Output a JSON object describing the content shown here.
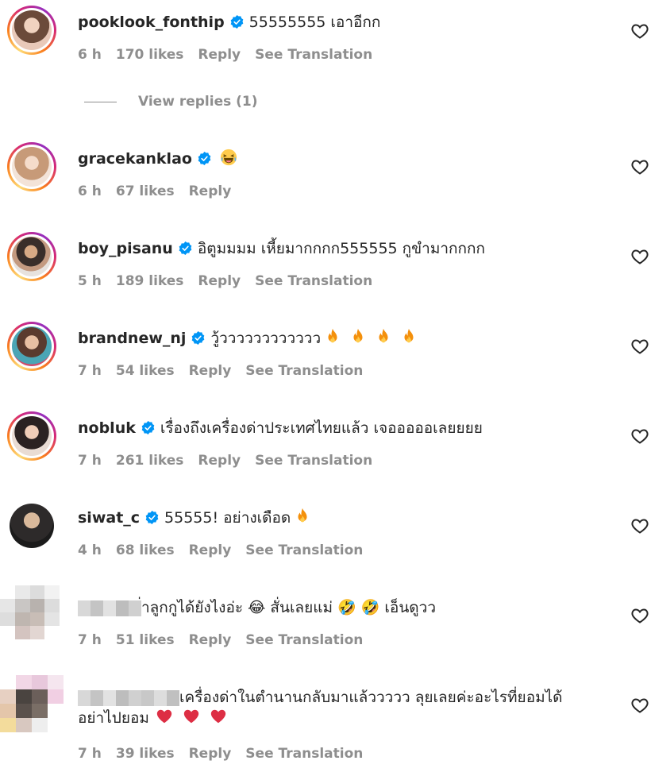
{
  "comments": [
    {
      "username": "pooklook_fonthip",
      "verified": true,
      "text": "55555555 เอาอีกก",
      "emojis": [],
      "time": "6 h",
      "likes": "170 likes",
      "reply": "Reply",
      "translation": "See Translation",
      "replies_link": "View replies (1)"
    },
    {
      "username": "gracekanklao",
      "verified": true,
      "text": "",
      "emojis": [
        "laughing"
      ],
      "time": "6 h",
      "likes": "67 likes",
      "reply": "Reply",
      "translation": ""
    },
    {
      "username": "boy_pisanu",
      "verified": true,
      "text": "อิตูมมมม เหี้ยมากกกก555555 กูขำมากกกก",
      "emojis": [],
      "time": "5 h",
      "likes": "189 likes",
      "reply": "Reply",
      "translation": "See Translation"
    },
    {
      "username": "brandnew_nj",
      "verified": true,
      "text": "วู้วววววววววววว",
      "emojis": [
        "fire",
        "fire",
        "fire",
        "fire"
      ],
      "time": "7 h",
      "likes": "54 likes",
      "reply": "Reply",
      "translation": "See Translation"
    },
    {
      "username": "nobluk",
      "verified": true,
      "text": "เรื่องถึงเครื่องด่าประเทศไทยแล้ว เจอออออเลยยยย",
      "emojis": [],
      "time": "7 h",
      "likes": "261 likes",
      "reply": "Reply",
      "translation": "See Translation"
    },
    {
      "username": "siwat_c",
      "verified": true,
      "text": "55555! อย่างเดือด",
      "emojis": [
        "fire"
      ],
      "time": "4 h",
      "likes": "68 likes",
      "reply": "Reply",
      "translation": "See Translation"
    },
    {
      "username": "",
      "verified": false,
      "text": "่าลูกกูได้ยังไงอ่ะ 😂 สั่นเลยแม่ 🤣 🤣 เอ็นดูวว",
      "emojis": [],
      "time": "7 h",
      "likes": "51 likes",
      "reply": "Reply",
      "translation": "See Translation"
    },
    {
      "username": "",
      "verified": false,
      "text": "เครื่องด่าในตำนานกลับมาแล้ววววว ลุยเลยค่ะอะไรที่ยอมได้อย่าไปยอม",
      "emojis": [
        "heart",
        "heart",
        "heart"
      ],
      "time": "7 h",
      "likes": "39 likes",
      "reply": "Reply",
      "translation": "See Translation"
    }
  ],
  "colors": {
    "text": "#262626",
    "meta": "#8e8e8e",
    "verified": "#0095f6",
    "fire": "#f4900c",
    "heart_emoji": "#dd2e44"
  }
}
